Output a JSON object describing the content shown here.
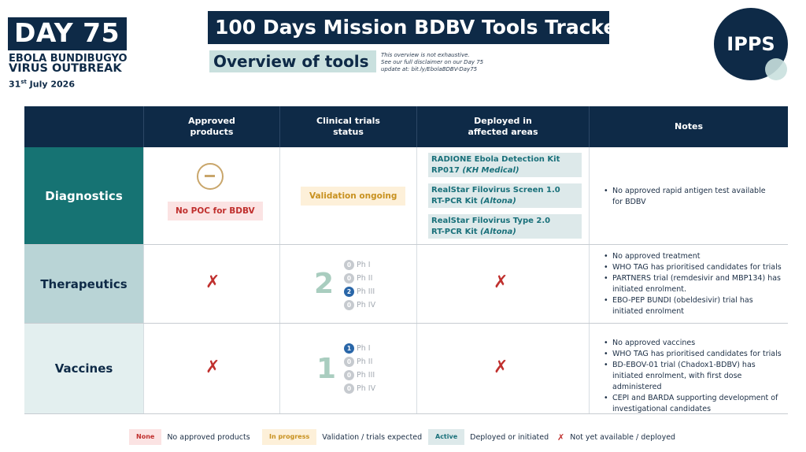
{
  "header": {
    "day": "DAY 75",
    "outbreak_line1": "EBOLA BUNDIBUGYO",
    "outbreak_line2": "VIRUS OUTBREAK",
    "date_day": "31",
    "date_suffix": "st",
    "date_rest": " July 2026",
    "title": "100 Days Mission BDBV Tools Tracker",
    "subtitle": "Overview of tools",
    "disclaimer_line1": "This overview is not exhaustive.",
    "disclaimer_line2": "See our full disclaimer on our Day 75",
    "disclaimer_line3": "update at: bit.ly/EbolaBDBV-Day75",
    "logo": "IPPS"
  },
  "columns": [
    "",
    "Approved products",
    "Clinical trials status",
    "Deployed in affected areas",
    "Notes"
  ],
  "rows": [
    {
      "name": "Diagnostics",
      "approved_badge": "No POC for BDBV",
      "approved_icon": "minus-circle-icon",
      "trials_badge": "Validation ongoing",
      "deployed": [
        {
          "line1": "RADIONE Ebola Detection Kit",
          "line2": "RP017 ",
          "line2_italic": "(KH Medical)"
        },
        {
          "line1": "RealStar Filovirus Screen 1.0",
          "line2": "RT-PCR Kit ",
          "line2_italic": "(Altona)"
        },
        {
          "line1": "RealStar Filovirus Type 2.0",
          "line2": "RT-PCR Kit ",
          "line2_italic": "(Altona)"
        }
      ],
      "notes": [
        "No approved rapid antigen test available for BDBV"
      ]
    },
    {
      "name": "Therapeutics",
      "approved_symbol": "✗",
      "trials_total": "2",
      "phases": [
        {
          "count": "0",
          "label": "Ph I",
          "active": false
        },
        {
          "count": "0",
          "label": "Ph II",
          "active": false
        },
        {
          "count": "2",
          "label": "Ph III",
          "active": true
        },
        {
          "count": "0",
          "label": "Ph IV",
          "active": false
        }
      ],
      "deployed_symbol": "✗",
      "notes": [
        "No approved treatment",
        "WHO TAG has prioritised candidates for trials",
        "PARTNERS trial (remdesivir and MBP134) has initiated enrolment.",
        "EBO-PEP BUNDI (obeldesivir) trial has initiated enrolment"
      ]
    },
    {
      "name": "Vaccines",
      "approved_symbol": "✗",
      "trials_total": "1",
      "phases": [
        {
          "count": "1",
          "label": "Ph I",
          "active": true
        },
        {
          "count": "0",
          "label": "Ph II",
          "active": false
        },
        {
          "count": "0",
          "label": "Ph III",
          "active": false
        },
        {
          "count": "0",
          "label": "Ph IV",
          "active": false
        }
      ],
      "deployed_symbol": "✗",
      "notes": [
        "No approved vaccines",
        "WHO TAG has prioritised candidates for trials",
        "BD-EBOV-01 trial (Chadox1-BDBV) has initiated enrolment, with first dose administered",
        "CEPI and BARDA supporting development of investigational candidates"
      ]
    }
  ],
  "legend": [
    {
      "chip": "None",
      "text": "No approved products"
    },
    {
      "chip": "In progress",
      "text": "Validation / trials expected"
    },
    {
      "chip": "Active",
      "text": "Deployed or initiated"
    },
    {
      "symbol": "✗",
      "text": "Not yet available / deployed"
    }
  ],
  "colors": {
    "navy": "#0e2a47",
    "teal": "#167373",
    "none_red": "#c0302e",
    "progress_gold": "#c8911f",
    "active_teal": "#19707a"
  }
}
